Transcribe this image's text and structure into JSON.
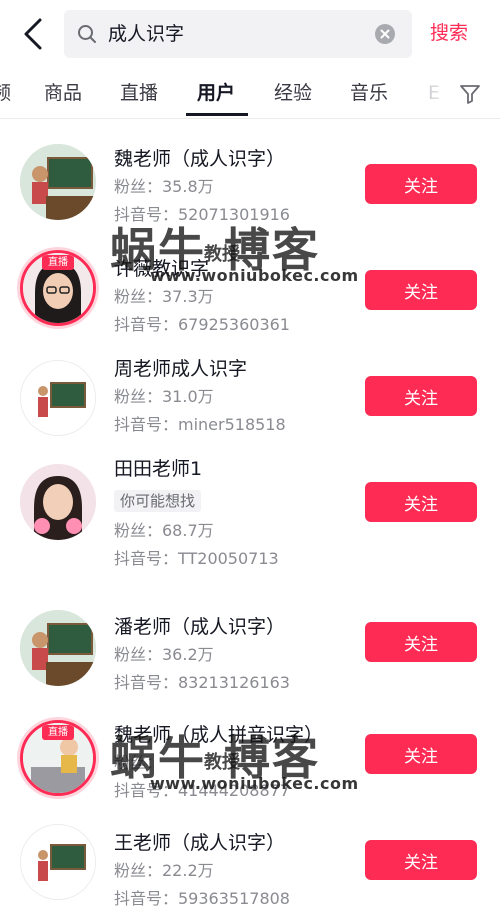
{
  "search": {
    "query": "成人识字",
    "submit_label": "搜索"
  },
  "tabs": {
    "items": [
      {
        "label": "频",
        "active": false
      },
      {
        "label": "商品",
        "active": false
      },
      {
        "label": "直播",
        "active": false
      },
      {
        "label": "用户",
        "active": true
      },
      {
        "label": "经验",
        "active": false
      },
      {
        "label": "音乐",
        "active": false
      },
      {
        "label": "Ε",
        "active": false
      }
    ]
  },
  "live_tag": "直播",
  "users": [
    {
      "name": "魏老师（成人识字）",
      "fans": "粉丝：35.8万",
      "id": "抖音号：52071301916",
      "follow": "关注",
      "live": false
    },
    {
      "name": "许薇教识字",
      "fans": "粉丝：37.3万",
      "id": "抖音号：67925360361",
      "follow": "关注",
      "live": true
    },
    {
      "name": "周老师成人识字",
      "fans": "粉丝：31.0万",
      "id": "抖音号：miner518518",
      "follow": "关注",
      "live": false
    },
    {
      "name": "田田老师1",
      "chip": "你可能想找",
      "fans": "粉丝：68.7万",
      "id": "抖音号：TT20050713",
      "follow": "关注",
      "live": false
    },
    {
      "name": "潘老师（成人识字）",
      "fans": "粉丝：36.2万",
      "id": "抖音号：83213126163",
      "follow": "关注",
      "live": false
    },
    {
      "name": "魏老师（成人拼音识字）",
      "fans": "粉丝：",
      "id": "抖音号：41444208877",
      "follow": "关注",
      "live": true
    },
    {
      "name": "王老师（成人识字）",
      "fans": "粉丝：22.2万",
      "id": "抖音号：59363517808",
      "follow": "关注",
      "live": false
    }
  ],
  "watermark": {
    "text": "蜗牛 博客",
    "sub": "教授",
    "url": "www.woniubokec.com"
  },
  "colors": {
    "accent": "#fe2c55",
    "text": "#161823",
    "secondary": "#8a8b91",
    "search_bg": "#f2f2f4"
  }
}
